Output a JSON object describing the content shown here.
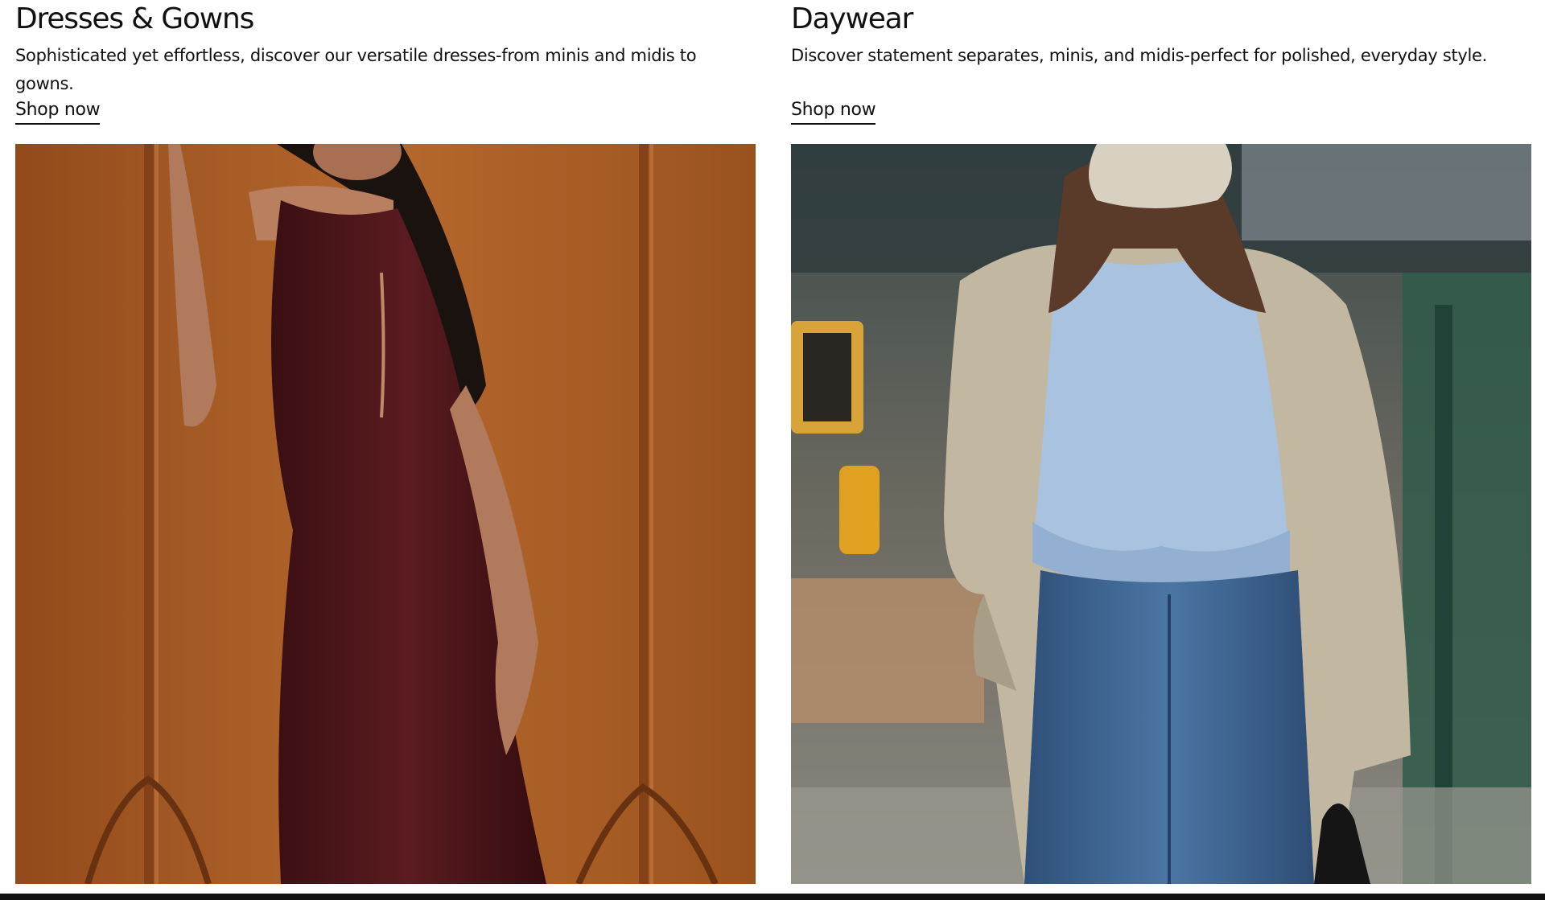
{
  "cards": [
    {
      "title": "Dresses & Gowns",
      "description": "Sophisticated yet effortless, discover our versatile dresses-from minis and midis to gowns.",
      "cta": "Shop now",
      "image_icon": "dress-model-photo"
    },
    {
      "title": "Daywear",
      "description": "Discover statement separates, minis, and midis-perfect for polished, everyday style.",
      "cta": "Shop now",
      "image_icon": "daywear-model-photo"
    }
  ],
  "colors": {
    "text": "#111111",
    "background": "#ffffff",
    "wood": "#b5652a",
    "dress": "#4a1518",
    "denim": "#3f6690",
    "blouse": "#a9c2df",
    "trench": "#c7bda6"
  }
}
